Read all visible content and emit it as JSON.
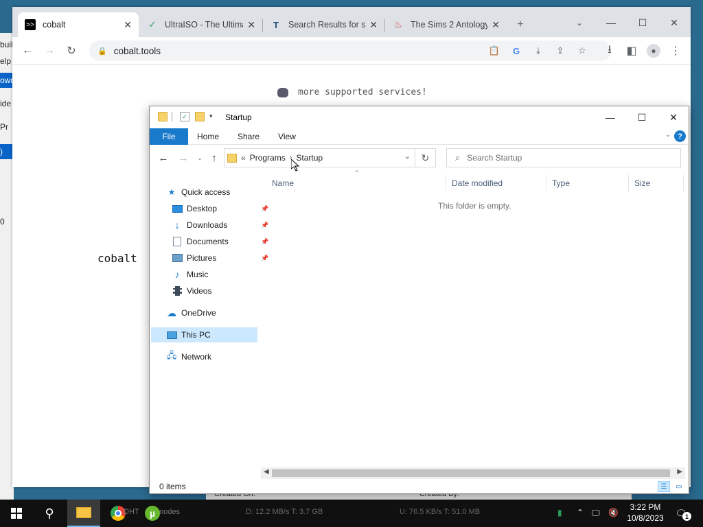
{
  "bg_app": {
    "items": [
      "buil",
      "elp",
      "own",
      "ide",
      "Pr",
      ")",
      "0"
    ]
  },
  "browser": {
    "tabs": [
      {
        "title": "cobalt",
        "favicon": "terminal-icon"
      },
      {
        "title": "UltraISO - The Ultima",
        "favicon": "ultraiso-icon"
      },
      {
        "title": "Search Results for sin",
        "favicon": "t2-icon"
      },
      {
        "title": "The Sims 2 Antology",
        "favicon": "flame-icon"
      }
    ],
    "url": "cobalt.tools",
    "page": {
      "supported_text": "more supported services!",
      "logo_text": "cobalt"
    }
  },
  "explorer": {
    "title": "Startup",
    "ribbon_tabs": [
      "File",
      "Home",
      "Share",
      "View"
    ],
    "help": "?",
    "breadcrumb": {
      "prefix": "«",
      "segments": [
        "Programs",
        "Startup"
      ]
    },
    "search_placeholder": "Search Startup",
    "columns": [
      "Name",
      "Date modified",
      "Type",
      "Size"
    ],
    "empty_message": "This folder is empty.",
    "nav": {
      "quick_access": "Quick access",
      "items": [
        "Desktop",
        "Downloads",
        "Documents",
        "Pictures",
        "Music",
        "Videos"
      ],
      "onedrive": "OneDrive",
      "this_pc": "This PC",
      "network": "Network"
    },
    "status": "0 items"
  },
  "background": {
    "created_on": "Created On:",
    "created_by": "Created By:",
    "down_rate": "D: 12.2 MB/s T: 3.7 GB",
    "up_rate": "U: 76.5 KB/s T: 51.0 MB",
    "partial_label": "DHT",
    "partial_label2": "nodes"
  },
  "taskbar": {
    "time": "3:22 PM",
    "date": "10/8/2023",
    "notification_count": "1"
  }
}
